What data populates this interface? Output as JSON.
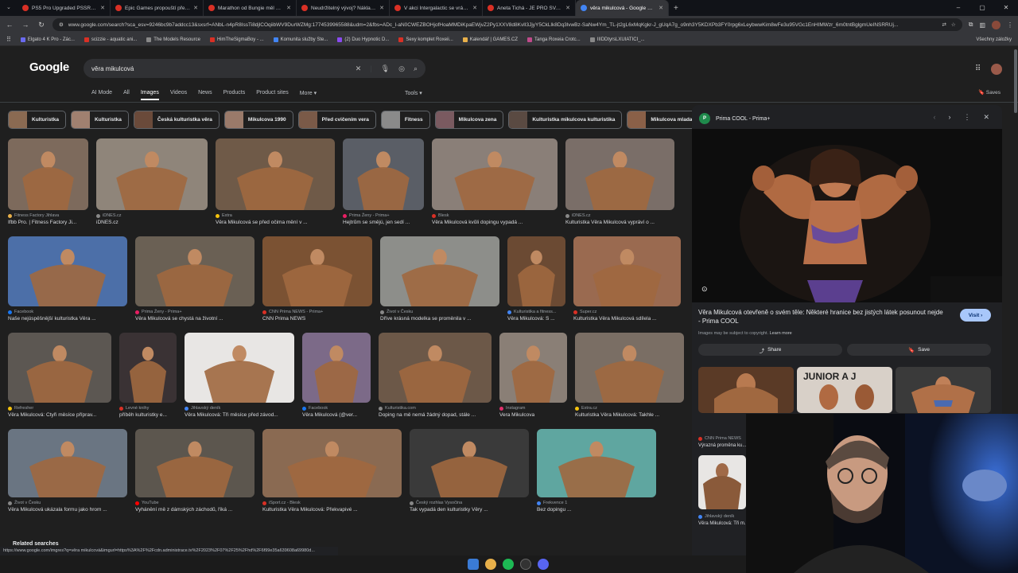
{
  "browser": {
    "tabs": [
      {
        "title": "PS5 Pro Upgraded PSSR = Enh...",
        "color": "#d93025"
      },
      {
        "title": "Epic Games propouští přes tisíc...",
        "color": "#d93025"
      },
      {
        "title": "Marathon od Bungie měl prodej...",
        "color": "#d93025"
      },
      {
        "title": "Neudržitelný vývoj? Náklady na...",
        "color": "#d93025"
      },
      {
        "title": "V akci Intergalactic se vrátí hr...",
        "color": "#d93025"
      },
      {
        "title": "Aneta Tichá - JE PRO SVALNAT...",
        "color": "#d93025"
      },
      {
        "title": "věra mikulcová - Google Search",
        "color": "#4285f4"
      }
    ],
    "new_tab": "+",
    "url": "www.google.com/search?sca_esv=9246bc9b7addcc13&sxsrf=ANbL-n4pR8IssTi8djlCOqiibWV9DurWZMg:1774539965588&udm=2&fbs=ADc_l-aN0CWEZBOHjofHoaMMDiKpaEWjvZ2Py1XXV8d8KvlI3JjyY5CkLlk8Dq3lvwBz-SaNw4Ym_TL-jt2gL6xMqKgkr-J_gUqA7g_o9nh3Y5KDXPb3FY0rpg6xLeybwwKim8wFe3u95VGc1EnHIMWzr_6m0tntBglgmUeINSRRUj...",
    "bookmarks": [
      "Elgato 4 K Pro - Zác...",
      "scizzie - aquatic ani...",
      "The Models Resource",
      "HimTheSigmaBoy - ...",
      "Komunita služby Ste...",
      "(2) Duo Hypnotic D...",
      "Sexy komplet Roxeii...",
      "Kalendář | GAMES.CZ",
      "Tanga Roxeia Crotc...",
      "IIIDDtyrsLXUIATICI_..."
    ],
    "bookmarks_right": "Všechny záložky"
  },
  "search": {
    "logo": "Google",
    "query": "věra mikulcová",
    "tabs": [
      "AI Mode",
      "All",
      "Images",
      "Videos",
      "News",
      "Products",
      "Product sites",
      "More ▾"
    ],
    "active_tab": "Images",
    "tools": "Tools ▾",
    "saves": "Saves"
  },
  "chips": [
    "Kulturistka",
    "Kulturistka",
    "Česká kulturistka věra",
    "Mikulcova 1990",
    "Před cvičením vera",
    "Fitness",
    "Mikulcova zena",
    "Kulturistka mikulcova kulturistika",
    "Mikulcova mlada"
  ],
  "results": [
    [
      {
        "src": "Fitness Factory Jihlava",
        "cap": "Ifbb Pro. | Fitness Factory Ji...",
        "w": 101,
        "h": 90,
        "bg": "#7d6a5c",
        "dot": "#e8b04a"
      },
      {
        "src": "iDNES.cz",
        "cap": "iDNES.cz",
        "w": 140,
        "h": 90,
        "bg": "#8f857a",
        "dot": "#888888"
      },
      {
        "src": "Extra",
        "cap": "Věra Mikulcová se před očima mění v ...",
        "w": 150,
        "h": 90,
        "bg": "#6f5a48",
        "dot": "#f4c20d"
      },
      {
        "src": "Prima Ženy - Prima+",
        "cap": "Hejtrům se smějú, jen sedí ...",
        "w": 102,
        "h": 90,
        "bg": "#5a5e66",
        "dot": "#e91e63"
      },
      {
        "src": "Blesk",
        "cap": "Věra Mikulcová kvůli dopingu vypadá ...",
        "w": 158,
        "h": 90,
        "bg": "#8a7f78",
        "dot": "#d93025"
      },
      {
        "src": "iDNES.cz",
        "cap": "Kulturistka Věra Mikulcová vypráví o ...",
        "w": 137,
        "h": 90,
        "bg": "#7a6e68",
        "dot": "#888888"
      }
    ],
    [
      {
        "src": "Facebook",
        "cap": "Naše nejúspěšnější kulturistka Věra ...",
        "w": 150,
        "h": 88,
        "bg": "#4c6fa8",
        "dot": "#1877f2"
      },
      {
        "src": "Prima Ženy - Prima+",
        "cap": "Věra Mikulcová se chystá na životní ...",
        "w": 150,
        "h": 88,
        "bg": "#6a6054",
        "dot": "#e91e63"
      },
      {
        "src": "CNN Prima NEWS - Prima+",
        "cap": "CNN Prima NEWS",
        "w": 138,
        "h": 88,
        "bg": "#7b5233",
        "dot": "#d93025"
      },
      {
        "src": "Život v Česku",
        "cap": "Dříve krásná modelka se proměnila v ...",
        "w": 150,
        "h": 88,
        "bg": "#8d8e8a",
        "dot": "#888888"
      },
      {
        "src": "Kulturistika a fitness...",
        "cap": "Věra Mikulcová: S ...",
        "w": 73,
        "h": 88,
        "bg": "#6b4a33",
        "dot": "#4285f4"
      },
      {
        "src": "Super.cz",
        "cap": "Kulturistka Věra Mikulcová sdílela ...",
        "w": 135,
        "h": 88,
        "bg": "#9a6a50",
        "dot": "#d93025"
      }
    ],
    [
      {
        "src": "Refresher",
        "cap": "Věra Mikulcová: Čtyři měsíce příprav...",
        "w": 130,
        "h": 88,
        "bg": "#5c5752",
        "dot": "#f4c20d"
      },
      {
        "src": "Levné knihy",
        "cap": "příběh kulturistky e...",
        "w": 72,
        "h": 88,
        "bg": "#3a3234",
        "dot": "#d93025"
      },
      {
        "src": "Jihlavský deník",
        "cap": "Věra Mikulcová: Tři měsíce před závod...",
        "w": 138,
        "h": 88,
        "bg": "#e8e6e4",
        "dot": "#4285f4"
      },
      {
        "src": "Facebook",
        "cap": "Věra Mikulcová (@ver...",
        "w": 86,
        "h": 88,
        "bg": "#7c6a88",
        "dot": "#1877f2"
      },
      {
        "src": "Kulturistika.com",
        "cap": "Doping na mě nemá žádný dopad, stále ...",
        "w": 142,
        "h": 88,
        "bg": "#6c5848",
        "dot": "#888888"
      },
      {
        "src": "Instagram",
        "cap": "Vera Mikulcova",
        "w": 85,
        "h": 88,
        "bg": "#8a7f76",
        "dot": "#e1306c"
      },
      {
        "src": "Extra.cz",
        "cap": "Kulturistka Věra Mikulcová: Takhle ...",
        "w": 137,
        "h": 88,
        "bg": "#7a6e64",
        "dot": "#f4c20d"
      }
    ],
    [
      {
        "src": "Život v Česku",
        "cap": "Věra Mikulcová ukázala formu jako hrom ...",
        "w": 150,
        "h": 86,
        "bg": "#6a7582",
        "dot": "#888888"
      },
      {
        "src": "YouTube",
        "cap": "Vyhánění mě z dámských záchodů, říká ...",
        "w": 150,
        "h": 86,
        "bg": "#5c564e",
        "dot": "#ff0000"
      },
      {
        "src": "iSport.cz - Blesk",
        "cap": "Kulturistka Věra Mikulcová: Překvapivé ...",
        "w": 175,
        "h": 86,
        "bg": "#8a6a52",
        "dot": "#d93025"
      },
      {
        "src": "Český rozhlas Vysočina",
        "cap": "Tak vypadá den kulturistky Věry ...",
        "w": 150,
        "h": 86,
        "bg": "#3a3a3a",
        "dot": "#888888"
      },
      {
        "src": "Frekvence 1",
        "cap": "Bez dopingu ...",
        "w": 150,
        "h": 86,
        "bg": "#5fa6a0",
        "dot": "#4285f4"
      }
    ]
  ],
  "related": "Related searches",
  "preview": {
    "source": "Prima COOL - Prima+",
    "source_logo": "P",
    "title": "Věra Mikulcová otevřeně o svém těle: Některé hranice bez jistých látek posunout nejde - Prima COOL",
    "visit": "Visit ›",
    "copyright": "Images may be subject to copyright.",
    "learn_more": "Learn more",
    "share": "Share",
    "save": "Save",
    "thumbs_src": "CNN Prima NEWS",
    "thumbs_cap": "Výrazná proměna ku...",
    "thumbs2_src": "Jihlavský deník",
    "thumbs2_cap": "Věra Mikulcová: Tři m..."
  },
  "statusbar": "https://www.google.com/imgres?q=věra mikulcová&imgurl=https%3A%2F%2Fcdn.administrace.tv%2F2023%2F07%2F25%2Fhd%2F6f99e35a639608a69980d..."
}
